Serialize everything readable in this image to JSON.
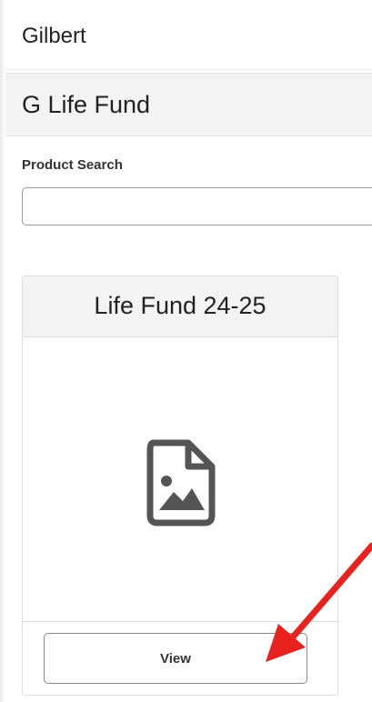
{
  "header": {
    "title": "Gilbert"
  },
  "section": {
    "title": "G Life Fund"
  },
  "search": {
    "label": "Product Search",
    "value": "",
    "placeholder": ""
  },
  "products": [
    {
      "title": "Life Fund 24-25",
      "image_icon": "image-file-icon",
      "button_label": "View"
    }
  ],
  "colors": {
    "header_bg": "#f3f3f3",
    "icon": "#555555",
    "annotation_arrow": "#e8231f"
  }
}
